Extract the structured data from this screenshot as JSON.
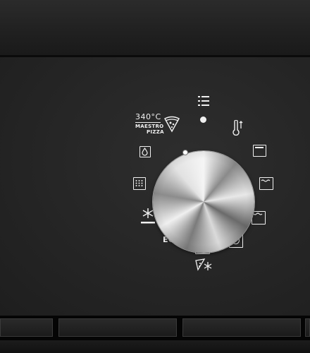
{
  "oven_panel": {
    "pizza_temp": "340°C",
    "pizza_brand_line1": "MAESTRO",
    "pizza_brand_line2": "PIZZA",
    "eco_label": "ECO"
  }
}
